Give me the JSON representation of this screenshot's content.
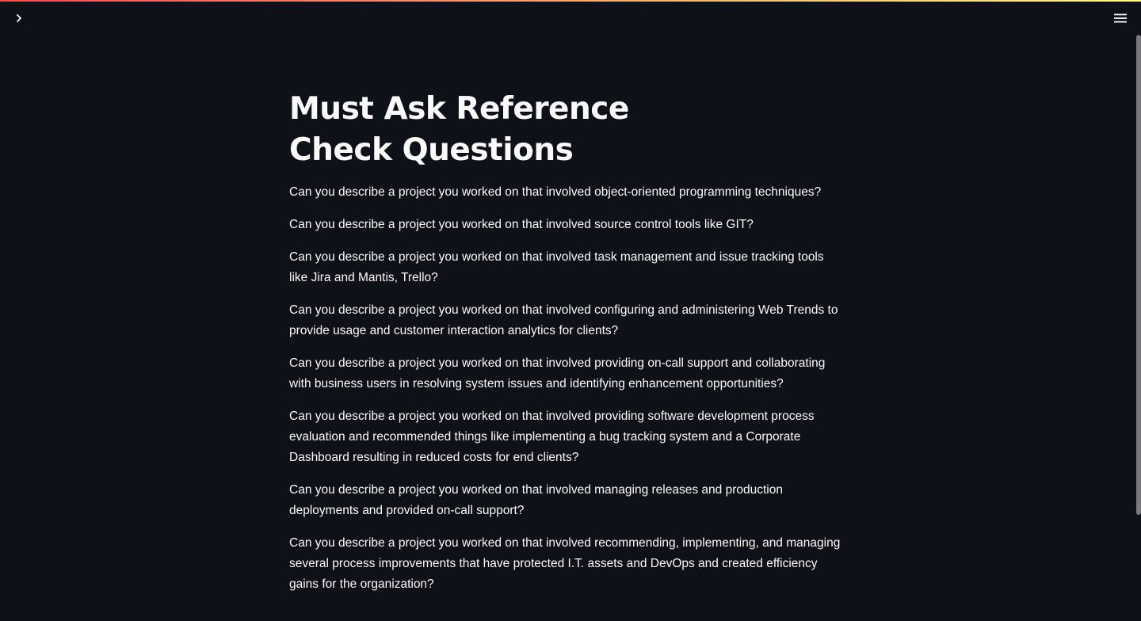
{
  "header": {
    "sidebar_toggle_icon": "chevron-right-icon",
    "menu_icon": "hamburger-menu-icon",
    "accent_gradient": [
      "#ff4b4b",
      "#fffd80"
    ]
  },
  "theme": {
    "background": "#0e1117",
    "text": "#fafafa"
  },
  "main": {
    "title": "Must Ask Reference Check Questions",
    "questions": [
      "Can you describe a project you worked on that involved object-oriented programming techniques?",
      "Can you describe a project you worked on that involved source control tools like GIT?",
      "Can you describe a project you worked on that involved task management and issue tracking tools like Jira and Mantis, Trello?",
      "Can you describe a project you worked on that involved configuring and administering Web Trends to provide usage and customer interaction analytics for clients?",
      "Can you describe a project you worked on that involved providing on-call support and collaborating with business users in resolving system issues and identifying enhancement opportunities?",
      "Can you describe a project you worked on that involved providing software development process evaluation and recommended things like implementing a bug tracking system and a Corporate Dashboard resulting in reduced costs for end clients?",
      "Can you describe a project you worked on that involved managing releases and production deployments and provided on-call support?",
      "Can you describe a project you worked on that involved recommending, implementing, and managing several process improvements that have protected I.T. assets and DevOps and created efficiency gains for the organization?"
    ]
  }
}
